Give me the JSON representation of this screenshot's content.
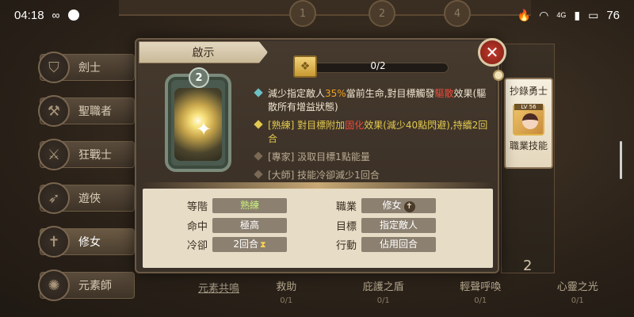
{
  "status_bar": {
    "time": "04:18",
    "battery": "76",
    "network_label": "4G"
  },
  "top_tabs": [
    "1",
    "2",
    "4"
  ],
  "sidebar": {
    "items": [
      {
        "label": "劍士"
      },
      {
        "label": "聖職者"
      },
      {
        "label": "狂戰士"
      },
      {
        "label": "遊俠"
      },
      {
        "label": "修女"
      },
      {
        "label": "元素師"
      }
    ]
  },
  "bottom": {
    "element_link": "元素共鳴",
    "tabs": [
      {
        "label": "救助",
        "count": "0/1"
      },
      {
        "label": "庇護之盾",
        "count": "0/1"
      },
      {
        "label": "輕聲呼喚",
        "count": "0/1"
      },
      {
        "label": "心靈之光",
        "count": "0/1"
      }
    ]
  },
  "right": {
    "copy_title": "抄錄勇士",
    "portrait_level": "LV 56",
    "copy_skill": "職業技能",
    "bottom_number": "2"
  },
  "popup": {
    "title": "啟示",
    "progress_text": "0/2",
    "progress": 0,
    "card_badge": "2",
    "desc": {
      "main_a": "減少指定敵人",
      "main_pct": "35%",
      "main_b": "當前生命,對目標觸發",
      "main_red": "驅散",
      "main_c": "效果(驅散所有增益狀態)",
      "skilled_a": "[熟練] 對目標附加",
      "skilled_red": "固化",
      "skilled_b": "效果(減少40點閃避),持續2回合",
      "expert": "[專家] 汲取目標1點能量",
      "master": "[大師] 技能冷卻減少1回合"
    },
    "stats": {
      "grade_label": "等階",
      "grade_value": "熟練",
      "hit_label": "命中",
      "hit_value": "極高",
      "cd_label": "冷卻",
      "cd_value": "2回合",
      "job_label": "職業",
      "job_value": "修女",
      "target_label": "目標",
      "target_value": "指定敵人",
      "action_label": "行動",
      "action_value": "佔用回合"
    }
  },
  "colors": {
    "accent_gold": "#d8a83a",
    "close_red": "#c43a2c",
    "highlight_orange": "#f0a020",
    "highlight_red": "#ef4b3a"
  }
}
